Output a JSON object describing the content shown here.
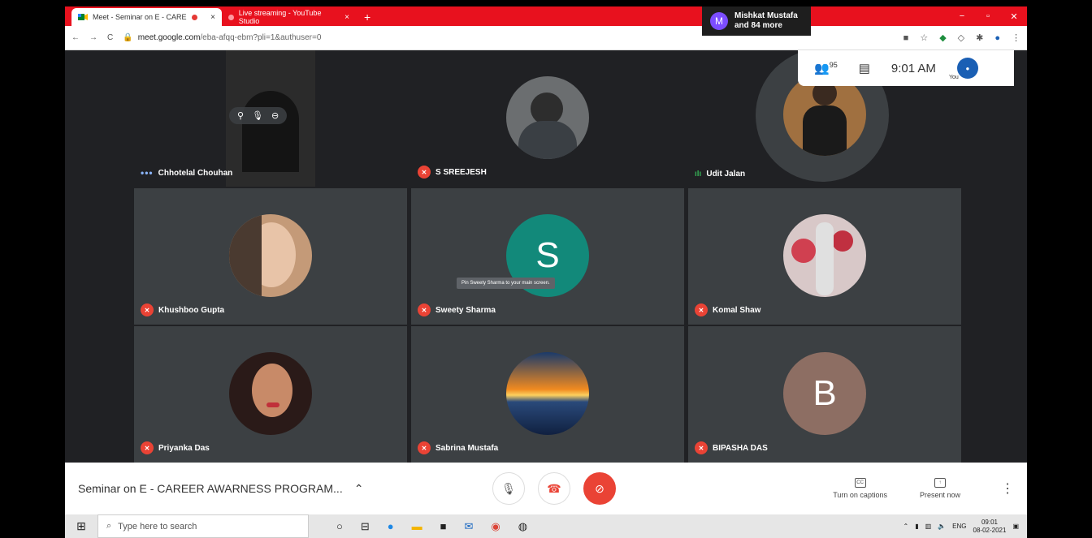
{
  "browser": {
    "tabs": [
      {
        "title": "Meet - Seminar on E - CARE",
        "close": "×"
      },
      {
        "title": "Live streaming - YouTube Studio",
        "close": "×"
      }
    ],
    "new_tab": "+",
    "window_controls": {
      "minimize": "−",
      "maximize": "▫",
      "close": "✕"
    },
    "url_host": "meet.google.com",
    "url_path": "/eba-afqq-ebm?pli=1&authuser=0"
  },
  "meet": {
    "active_speaker": {
      "initial": "M",
      "name": "Mishkat Mustafa",
      "more": "and 84 more"
    },
    "people_count": "95",
    "time": "9:01 AM",
    "you_label": "You",
    "participants": [
      {
        "name": "Chhotelal Chouhan",
        "status": "dots"
      },
      {
        "name": "S SREEJESH",
        "status": "muted"
      },
      {
        "name": "Udit Jalan",
        "status": "speaking"
      },
      {
        "name": "Khushboo Gupta",
        "status": "muted"
      },
      {
        "name": "Sweety Sharma",
        "status": "muted",
        "initial": "S"
      },
      {
        "name": "Komal Shaw",
        "status": "muted"
      },
      {
        "name": "Priyanka Das",
        "status": "muted"
      },
      {
        "name": "Sabrina Mustafa",
        "status": "muted"
      },
      {
        "name": "BIPASHA DAS",
        "status": "muted",
        "initial": "B"
      }
    ],
    "tooltip": "Pin Sweety Sharma to your main screen.",
    "meeting_title": "Seminar on E - CAREER AWARNESS PROGRAM...",
    "captions_label": "Turn on captions",
    "captions_icon": "CC",
    "present_label": "Present now"
  },
  "taskbar": {
    "search_placeholder": "Type here to search",
    "lang": "ENG",
    "time": "09:01",
    "date": "08-02-2021"
  }
}
